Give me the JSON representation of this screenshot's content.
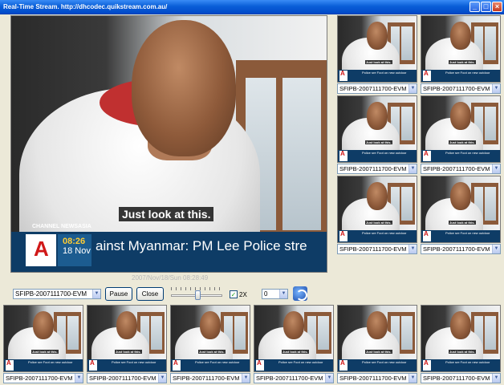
{
  "window": {
    "title": "Real-Time Stream.  http://dhcodec.quikstream.com.au/",
    "minimize": "_",
    "maximize": "□",
    "close": "×"
  },
  "broadcast": {
    "subtitle": "Just look at this.",
    "channel": "CHANNEL NEWSASIA",
    "ticker_main": "ainst Myanmar: PM Lee    Police stre",
    "ticker_small": "Police sre Foot on new outdoor",
    "time": "08:26",
    "date": "18 Nov",
    "logo": "A"
  },
  "main_controls": {
    "timestamp": "2007/Nov/18/Sun 08:28:49",
    "stream_select": "SFIPB-2007111700-EVM",
    "pause_label": "Pause",
    "close_label": "Close",
    "zoom_checked": true,
    "zoom_label": "2X",
    "channel_select": "0",
    "arrow": "▼",
    "check_mark": "✓"
  },
  "thumbnails": {
    "right": [
      {
        "stream": "SFIPB-2007111700-EVM"
      },
      {
        "stream": "SFIPB-2007111700-EVM"
      },
      {
        "stream": "SFIPB-2007111700-EVM"
      },
      {
        "stream": "SFIPB-2007111700-EVM"
      },
      {
        "stream": "SFIPB-2007111700-EVM"
      },
      {
        "stream": "SFIPB-2007111700-EVM"
      }
    ],
    "bottom": [
      {
        "stream": "SFIPB-2007111700-EVM"
      },
      {
        "stream": "SFIPB-2007111700-EVM"
      },
      {
        "stream": "SFIPB-2007111700-EVM"
      },
      {
        "stream": "SFIPB-2007111700-EVM"
      },
      {
        "stream": "SFIPB-2007111700-EVM"
      },
      {
        "stream": "SFIPB-2007111700-EVM"
      }
    ]
  }
}
